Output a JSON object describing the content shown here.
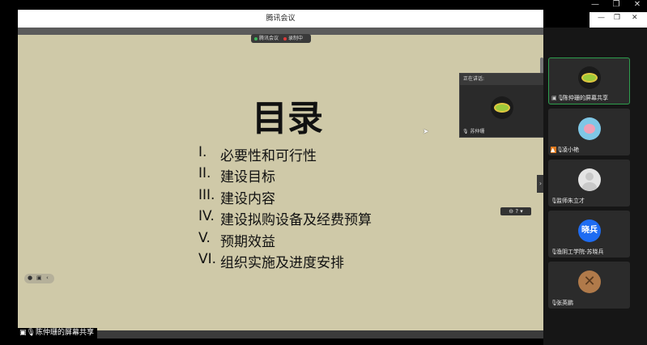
{
  "window": {
    "title": "腾讯会议",
    "outer_controls": [
      "—",
      "❐",
      "✕"
    ],
    "inner_controls": [
      "—",
      "❐",
      "✕"
    ]
  },
  "meeting_status": {
    "app_label": "腾讯会议",
    "recording_label": "录制中"
  },
  "slide": {
    "title": "目录",
    "items": [
      {
        "num": "I.",
        "text": "必要性和可行性"
      },
      {
        "num": "II.",
        "text": "建设目标"
      },
      {
        "num": "III.",
        "text": "建设内容"
      },
      {
        "num": "IV.",
        "text": "建设拟购设备及经费预算"
      },
      {
        "num": "V.",
        "text": "预期效益"
      },
      {
        "num": "VI.",
        "text": "组织实施及进度安排"
      }
    ]
  },
  "sharer_label": "陈仲珊的屏幕共享",
  "speaking": {
    "header": "正在讲话:",
    "name": "苏仲珊"
  },
  "participants": [
    {
      "name": "陈仲珊的屏幕共享",
      "avatar": "leaf-avatar",
      "active": true
    },
    {
      "name": "凌小艳",
      "avatar": "pig-avatar",
      "active": false
    },
    {
      "name": "监师朱立才",
      "avatar": "default-avatar",
      "active": false
    },
    {
      "name": "渔阴工学院-苏晓兵",
      "avatar": "text-avatar",
      "avatar_text": "晓兵",
      "active": false
    },
    {
      "name": "张英鹏",
      "avatar": "wood-avatar",
      "active": false
    }
  ],
  "colors": {
    "slide_bg": "#cfc9a8",
    "active_border": "#2e9d4d",
    "panel_bg": "#161616"
  }
}
